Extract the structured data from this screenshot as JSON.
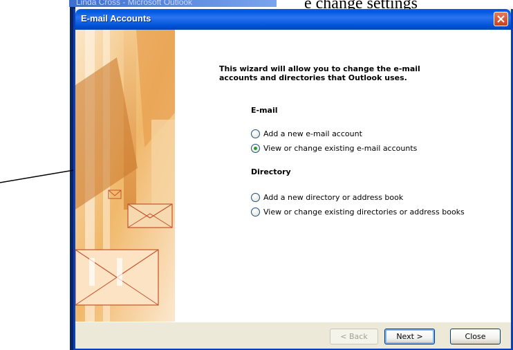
{
  "background": {
    "window_title": "Linda Cross - Microsoft Outlook",
    "doc_text": "e change settings"
  },
  "dialog": {
    "title": "E-mail Accounts",
    "headline": "This wizard will allow you to change the e-mail accounts and directories that Outlook uses.",
    "email_section": {
      "label": "E-mail",
      "options": [
        {
          "label": "Add a new e-mail account",
          "checked": false
        },
        {
          "label": "View or change existing e-mail accounts",
          "checked": true
        }
      ]
    },
    "directory_section": {
      "label": "Directory",
      "options": [
        {
          "label": "Add a new directory or address book",
          "checked": false
        },
        {
          "label": "View or change existing directories or address books",
          "checked": false
        }
      ]
    },
    "buttons": {
      "back": "< Back",
      "next": "Next >",
      "close": "Close"
    }
  },
  "colors": {
    "titlebar": "#0058e0",
    "close_button": "#c7401e",
    "radio_checked": "#2e9b2e"
  }
}
